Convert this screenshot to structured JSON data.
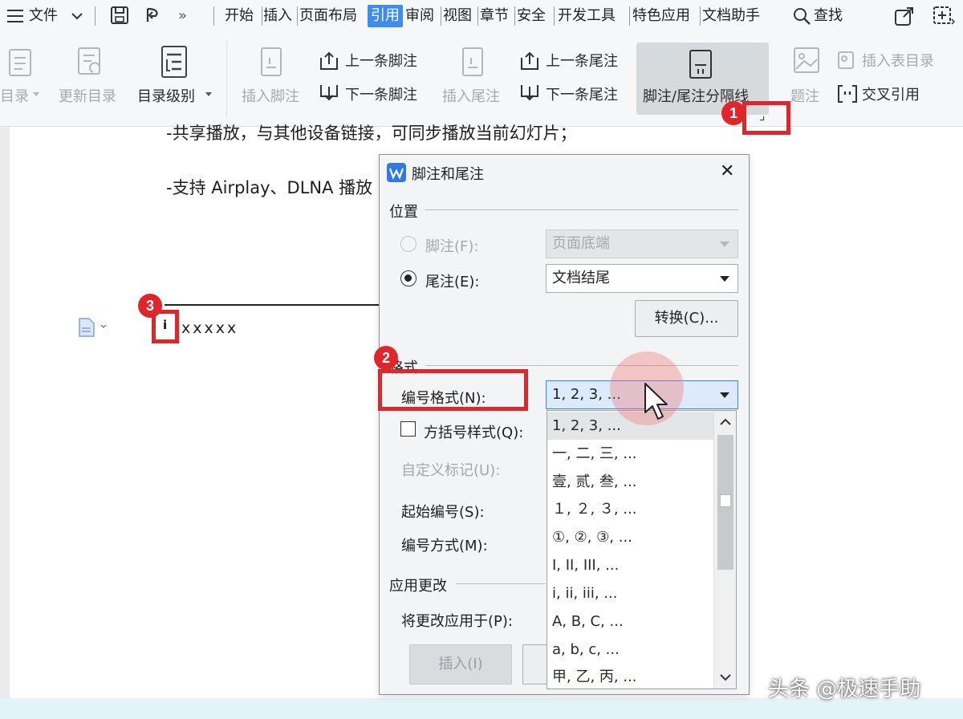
{
  "menubar": {
    "file_label": "文件",
    "expand_glyph": "»",
    "tabs": [
      "开始",
      "插入",
      "页面布局",
      "引用",
      "审阅",
      "视图",
      "章节",
      "安全",
      "开发工具",
      "特色应用",
      "文档助手"
    ],
    "active_tab": "引用",
    "search_label": "查找"
  },
  "ribbon": {
    "toc_label": "目录",
    "update_toc_label": "更新目录",
    "toc_level_label": "目录级别",
    "insert_footnote_label": "插入脚注",
    "prev_footnote_label": "上一条脚注",
    "next_footnote_label": "下一条脚注",
    "insert_endnote_label": "插入尾注",
    "prev_endnote_label": "上一条尾注",
    "next_endnote_label": "下一条尾注",
    "footnote_separator_label": "脚注/尾注分隔线",
    "caption_label": "题注",
    "insert_table_of_figures_label": "插入表目录",
    "cross_reference_label": "交叉引用",
    "dialog_launcher_glyph": "⌟"
  },
  "document": {
    "line1": "-共享播放，与其他设备链接，可同步播放当前幻灯片；",
    "line2": "-支持 Airplay、DLNA 播放",
    "endnote_mark": "i",
    "endnote_text": "xxxxx"
  },
  "badges": {
    "b1": "1",
    "b2": "2",
    "b3": "3"
  },
  "dialog": {
    "title": "脚注和尾注",
    "close_glyph": "✕",
    "position_section": "位置",
    "footnote_label": "脚注(F):",
    "footnote_location": "页面底端",
    "endnote_label": "尾注(E):",
    "endnote_location": "文档结尾",
    "convert_button": "转换(C)...",
    "format_section": "格式",
    "number_format_label": "编号格式(N):",
    "number_format_value": "1, 2, 3, ...",
    "bracket_style_label": "方括号样式(Q):",
    "custom_mark_label": "自定义标记(U):",
    "start_number_label": "起始编号(S):",
    "numbering_label": "编号方式(M):",
    "apply_section": "应用更改",
    "apply_to_label": "将更改应用于(P):",
    "insert_button": "插入(I)",
    "format_options": [
      "1, 2, 3, ...",
      "一, 二, 三, ...",
      "壹, 贰, 叁, ...",
      "１, ２, ３, ...",
      "①, ②, ③, ...",
      "I, II, III, ...",
      "i, ii, iii, ...",
      "A, B, C, ...",
      "a, b, c, ...",
      "甲, 乙, 丙, ..."
    ]
  },
  "watermark": "头条 @极速手助",
  "colors": {
    "active_tab": "#3f8cf0",
    "badge": "#e0262b",
    "highlight_box": "#e0262b"
  }
}
